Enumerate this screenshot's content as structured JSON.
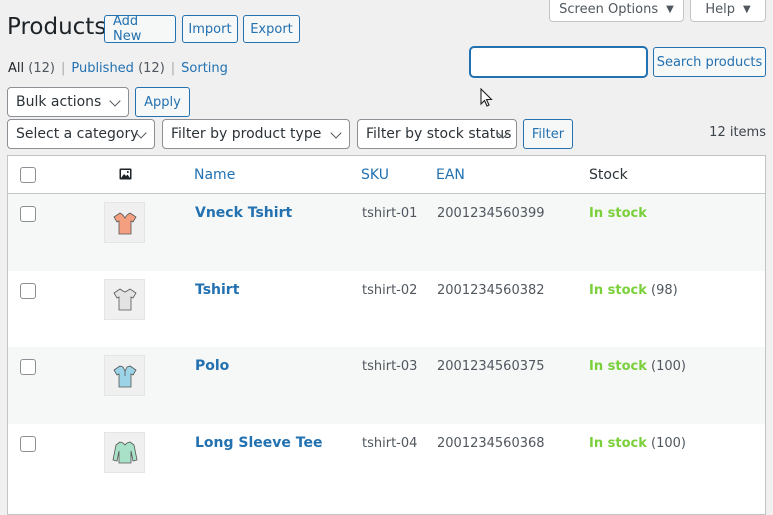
{
  "top_tabs": {
    "screen_options": "Screen Options",
    "help": "Help"
  },
  "header": {
    "title": "Products",
    "add_new": "Add New",
    "import": "Import",
    "export": "Export"
  },
  "views": {
    "all_label": "All",
    "all_count": "(12)",
    "published_label": "Published",
    "published_count": "(12)",
    "sorting_label": "Sorting",
    "separator": "|"
  },
  "search": {
    "value": "",
    "button": "Search products"
  },
  "bulk": {
    "selected": "Bulk actions",
    "apply": "Apply"
  },
  "filters": {
    "category": "Select a category",
    "product_type": "Filter by product type",
    "stock_status": "Filter by stock status",
    "button": "Filter"
  },
  "items_count": "12 items",
  "table": {
    "columns": {
      "name": "Name",
      "sku": "SKU",
      "ean": "EAN",
      "stock": "Stock"
    },
    "rows": [
      {
        "name": "Vneck Tshirt",
        "sku": "tshirt-01",
        "ean": "2001234560399",
        "stock_status": "In stock",
        "stock_qty": "",
        "shirt_color": "#f4a080"
      },
      {
        "name": "Tshirt",
        "sku": "tshirt-02",
        "ean": "2001234560382",
        "stock_status": "In stock",
        "stock_qty": "(98)",
        "shirt_color": "#e3e3e3"
      },
      {
        "name": "Polo",
        "sku": "tshirt-03",
        "ean": "2001234560375",
        "stock_status": "In stock",
        "stock_qty": "(100)",
        "shirt_color": "#9cd3e6"
      },
      {
        "name": "Long Sleeve Tee",
        "sku": "tshirt-04",
        "ean": "2001234560368",
        "stock_status": "In stock",
        "stock_qty": "(100)",
        "shirt_color": "#a8e0c8"
      }
    ]
  },
  "colors": {
    "accent": "#2271b1",
    "in_stock": "#7ad03a"
  }
}
